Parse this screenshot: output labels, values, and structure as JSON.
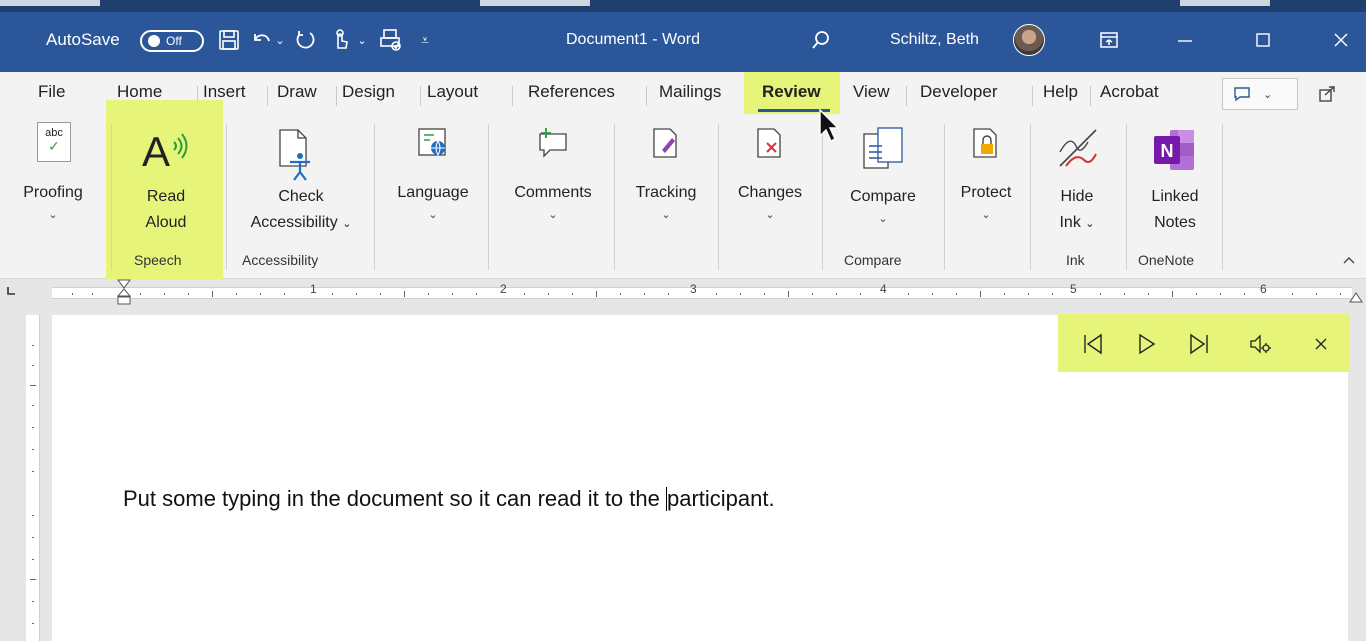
{
  "titlebar": {
    "autosave_label": "AutoSave",
    "autosave_state": "Off",
    "document_title": "Document1 - Word",
    "user_name": "Schiltz, Beth"
  },
  "tabs": [
    "File",
    "Home",
    "Insert",
    "Draw",
    "Design",
    "Layout",
    "References",
    "Mailings",
    "Review",
    "View",
    "Developer",
    "Help",
    "Acrobat"
  ],
  "active_tab": "Review",
  "ribbon": {
    "proofing": {
      "label": "Proofing",
      "icon_text": "abc"
    },
    "read_aloud": {
      "line1": "Read",
      "line2": "Aloud"
    },
    "check_accessibility": {
      "line1": "Check",
      "line2": "Accessibility"
    },
    "language": {
      "label": "Language"
    },
    "comments": {
      "label": "Comments"
    },
    "tracking": {
      "label": "Tracking"
    },
    "changes": {
      "label": "Changes"
    },
    "compare": {
      "label": "Compare"
    },
    "protect": {
      "label": "Protect"
    },
    "hide_ink": {
      "line1": "Hide",
      "line2": "Ink"
    },
    "linked_notes": {
      "line1": "Linked",
      "line2": "Notes"
    },
    "groups": {
      "speech": "Speech",
      "accessibility": "Accessibility",
      "compare": "Compare",
      "ink": "Ink",
      "onenote": "OneNote"
    }
  },
  "ruler": {
    "numbers": [
      "1",
      "2",
      "3",
      "4",
      "5",
      "6"
    ]
  },
  "document": {
    "text_before_cursor": "Put some typing in the document so it can read it to the ",
    "text_after_cursor": "participant."
  },
  "colors": {
    "title_bar": "#2b579a",
    "highlight": "#e6f57a",
    "onenote_purple": "#7719aa"
  }
}
